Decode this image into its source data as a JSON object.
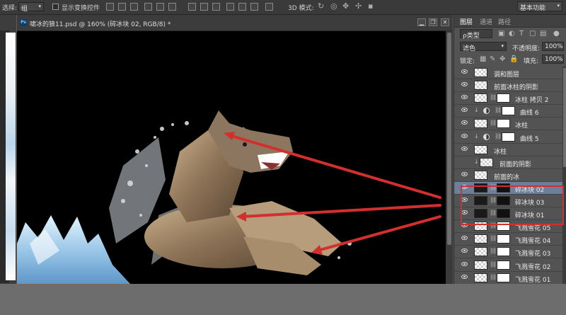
{
  "options_bar": {
    "select_label": "选择:",
    "select_value": "组",
    "show_transform_label": "显示变换控件",
    "mode3d_label": "3D 模式:",
    "workspace": "基本功能"
  },
  "document": {
    "title": "啸冰的狼11.psd @ 160% (碎冰块 02, RGB/8) *",
    "minimize": "▁",
    "restore": "❐",
    "close": "✕"
  },
  "panel": {
    "tabs": [
      "图层",
      "通道",
      "路径"
    ],
    "filter_kind": "ρ类型",
    "blend_mode": "滤色",
    "opacity_label": "不透明度:",
    "opacity_value": "100%",
    "lock_label": "锁定:",
    "fill_label": "填充:",
    "fill_value": "100%"
  },
  "layers": [
    {
      "name": "调和图层",
      "thumb": "checker",
      "visible": true
    },
    {
      "name": "前面冰柱的阴影",
      "thumb": "checker",
      "visible": true
    },
    {
      "name": "冰柱 拷贝 2",
      "thumb": "checker",
      "mask": "white",
      "visible": true
    },
    {
      "name": "曲线 6",
      "thumb": "adjustment",
      "mask": "white",
      "clipped": true,
      "visible": true
    },
    {
      "name": "冰柱",
      "thumb": "checker",
      "mask": "white",
      "visible": true
    },
    {
      "name": "曲线 5",
      "thumb": "adjustment",
      "mask": "white",
      "clipped": true,
      "visible": true
    },
    {
      "name": "冰柱",
      "thumb": "checker",
      "visible": true
    },
    {
      "name": "前面的阴影",
      "thumb": "checker",
      "clipped": true,
      "visible": false
    },
    {
      "name": "前面的冰",
      "thumb": "checker",
      "visible": true
    },
    {
      "name": "碎冰块 02",
      "thumb": "dark",
      "mask": "dark",
      "selected": true,
      "visible": true
    },
    {
      "name": "碎冰块 03",
      "thumb": "dark",
      "mask": "dark",
      "visible": true
    },
    {
      "name": "碎冰块 01",
      "thumb": "dark",
      "mask": "dark",
      "visible": true
    },
    {
      "name": "飞溅雪花 05",
      "thumb": "checker",
      "mask": "white",
      "visible": true
    },
    {
      "name": "飞溅雪花 04",
      "thumb": "checker",
      "mask": "white",
      "visible": true
    },
    {
      "name": "飞溅雪花 03",
      "thumb": "checker",
      "mask": "white",
      "visible": true
    },
    {
      "name": "飞溅雪花 02",
      "thumb": "checker",
      "mask": "white",
      "visible": true
    },
    {
      "name": "飞溅雪花 01",
      "thumb": "checker",
      "mask": "white",
      "visible": true
    }
  ],
  "colors": {
    "annotation_red": "#d22f2f",
    "selected_layer": "#6d7f99",
    "panel_bg": "#535353",
    "canvas_bg": "#000000"
  }
}
